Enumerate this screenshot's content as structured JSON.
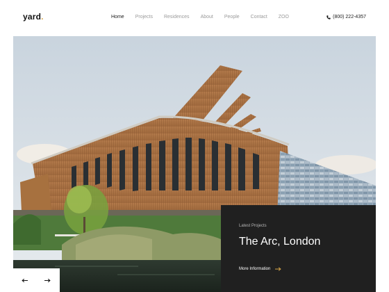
{
  "brand": {
    "logo_text": "yard",
    "logo_dot": "."
  },
  "nav": {
    "items": [
      {
        "label": "Home"
      },
      {
        "label": "Projects"
      },
      {
        "label": "Residences"
      },
      {
        "label": "About"
      },
      {
        "label": "People"
      },
      {
        "label": "Contact"
      },
      {
        "label": "ZOO"
      }
    ],
    "active_item": "Home"
  },
  "contact": {
    "phone": "(800) 222-4357",
    "icon": "phone-icon"
  },
  "hero": {
    "image": "wooden-arc-building-photo",
    "card": {
      "eyebrow": "Latest Projects",
      "title": "The Arc, London",
      "link_label": "More Information",
      "link_icon": "arrow-right-icon"
    },
    "controls": {
      "prev_icon": "arrow-left-icon",
      "next_icon": "arrow-right-icon"
    }
  },
  "colors": {
    "accent": "#d4a347",
    "card_bg": "#202020",
    "text_muted": "#9a9a9a"
  }
}
